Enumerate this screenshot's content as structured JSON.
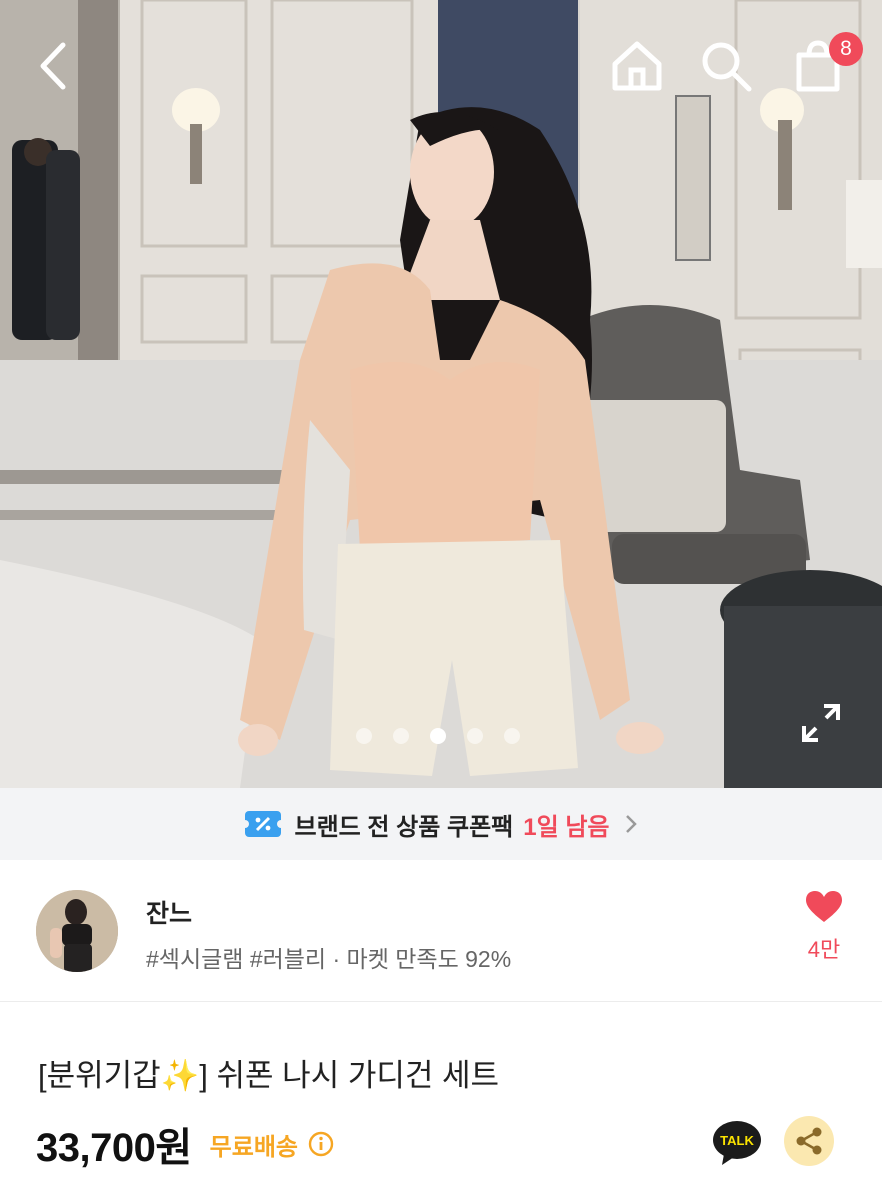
{
  "header": {
    "back_icon": "chevron-left-icon",
    "home_icon": "home-icon",
    "search_icon": "search-icon",
    "cart_icon": "shopping-bag-icon",
    "cart_count": "8"
  },
  "gallery": {
    "total_images": 5,
    "active_index": 2,
    "expand_icon": "expand-icon"
  },
  "coupon": {
    "label": "브랜드 전 상품 쿠폰팩",
    "remaining": "1일 남음",
    "icon": "coupon-icon",
    "chevron_icon": "chevron-right-icon"
  },
  "shop": {
    "name": "잔느",
    "tags": "#섹시글램 #러블리 · 마켓 만족도 92%",
    "like_count": "4만",
    "like_icon": "heart-icon"
  },
  "product": {
    "title": "[분위기갑✨] 쉬폰 나시 가디건 세트",
    "price": "33,700원",
    "shipping": "무료배송",
    "info_icon": "info-icon",
    "talk_label": "TALK",
    "share_icon": "share-icon"
  },
  "colors": {
    "accent_red": "#f04a5a",
    "shipping_orange": "#f6a623",
    "coupon_blue": "#3aa0ef",
    "coupon_bg": "#f3f4f6",
    "share_bg": "#fbe8b0"
  }
}
